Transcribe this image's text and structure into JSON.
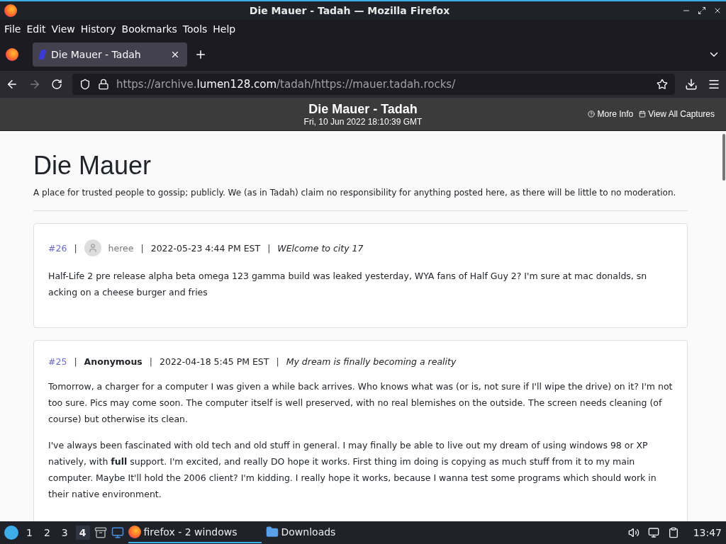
{
  "window": {
    "title": "Die Mauer - Tadah — Mozilla Firefox"
  },
  "menu": [
    "File",
    "Edit",
    "View",
    "History",
    "Bookmarks",
    "Tools",
    "Help"
  ],
  "tabs": [
    {
      "label": "Die Mauer - Tadah",
      "selected": true
    }
  ],
  "nav": {
    "url": {
      "prefix": "https://archive.",
      "host": "lumen128.com",
      "path": "/tadah/https://mauer.tadah.rocks/"
    },
    "forward_disabled": true
  },
  "archive_bar": {
    "title": "Die Mauer - Tadah",
    "date": "Fri, 10 Jun 2022 18:10:39 GMT",
    "links": [
      {
        "kind": "info",
        "label": "More Info"
      },
      {
        "kind": "captures",
        "label": "View All Captures"
      }
    ]
  },
  "page": {
    "heading": "Die Mauer",
    "description": "A place for trusted people to gossip; publicly. We (as in Tadah) claim no responsibility for anything posted here, as there will be little to no moderation.",
    "posts": [
      {
        "separator": "|",
        "number": "#26",
        "author": {
          "kind": "user",
          "name": "heree"
        },
        "date": "2022-05-23 4:44 PM EST",
        "subject": "WElcome to city 17",
        "paragraphs": [
          "Half-Life 2 pre release alpha beta omega 123 gamma build was leaked yesterday, WYA fans of Half Guy 2? I'm sure at mac donalds, sn acking on a cheese burger and fries"
        ]
      },
      {
        "separator": "|",
        "number": "#25",
        "author": {
          "kind": "anonymous",
          "name": "Anonymous"
        },
        "date": "2022-04-18 5:45 PM EST",
        "subject": "My dream is finally becoming a reality",
        "paragraphs": [
          "Tomorrow, a charger for a computer I was given a while back arrives. Who knows what was (or is, not sure if I'll wipe the drive) on it? I'm not too sure. Pics may come soon. The computer itself is well preserved, with no real blemishes on the outside. The screen needs cleaning (of course) but otherwise its clean.",
          "I've always been fascinated with old tech and old stuff in general. I may finally be able to live out my dream of using windows 98 or XP natively, with **full** support. I'm excited, and really DO hope it works. First thing im doing is copying as much stuff from it to my main computer. Maybe It'll hold the 2006 client? I'm kidding. I really hope it works, because I wanna test some programs which should work in their native environment."
        ]
      }
    ]
  },
  "taskbar": {
    "workspaces": [
      {
        "label": "1",
        "selected": false
      },
      {
        "label": "2",
        "selected": false
      },
      {
        "label": "3",
        "selected": false
      },
      {
        "label": "4",
        "selected": true
      }
    ],
    "tasks": [
      {
        "kind": "browser",
        "label": "firefox - 2 windows",
        "selected": true
      },
      {
        "kind": "folder",
        "label": "Downloads",
        "selected": false
      }
    ],
    "clock": "13:47"
  }
}
